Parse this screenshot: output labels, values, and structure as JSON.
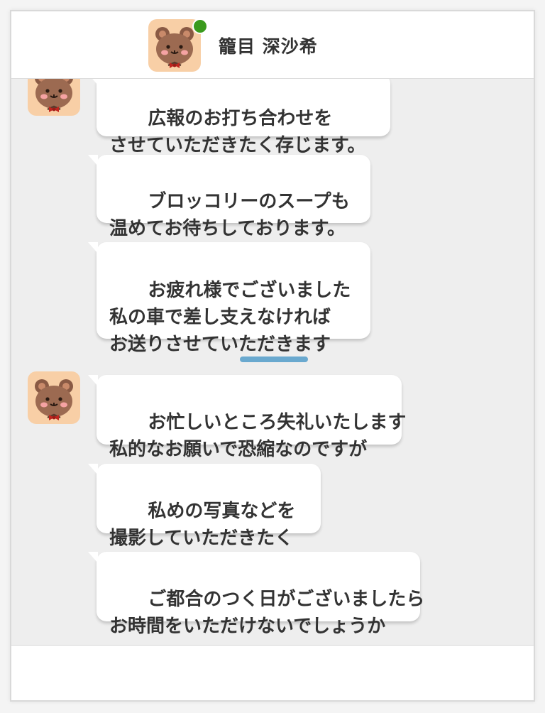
{
  "header": {
    "contact_name": "籠目 深沙希",
    "avatar_icon": "bear-avatar-icon",
    "online_status_color": "#3a9a1c"
  },
  "messages": [
    {
      "text": "広報のお打ち合わせを\nさせていただきたく存じます。"
    },
    {
      "text": "ブロッコリーのスープも\n温めてお待ちしております。"
    },
    {
      "text": "お疲れ様でございました\n私の車で差し支えなければ\nお送りさせていただきます"
    },
    {
      "text": "お忙しいところ失礼いたします\n私的なお願いで恐縮なのですが"
    },
    {
      "text": "私めの写真などを\n撮影していただきたく"
    },
    {
      "text": "ご都合のつく日がございましたら\nお時間をいただけないでしょうか"
    }
  ],
  "colors": {
    "divider": "#6aa9cf",
    "background": "#eeeeee",
    "avatar_bg": "#f8cfa6"
  }
}
